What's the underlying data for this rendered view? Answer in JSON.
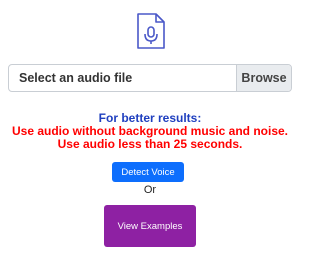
{
  "file_picker": {
    "label": "Select an audio file",
    "browse_label": "Browse"
  },
  "tips": {
    "heading": "For better results:",
    "line1": "Use audio without background music and noise.",
    "line2": "Use audio less than 25 seconds."
  },
  "actions": {
    "detect_label": "Detect Voice",
    "or_text": "Or",
    "examples_label": "View Examples"
  },
  "icons": {
    "file": "audio-file-icon"
  },
  "colors": {
    "icon": "#4a58c8",
    "heading": "#1f3fbf",
    "warning": "#ff0000",
    "detect_button": "#0d6efd",
    "examples_button": "#8e21a3"
  }
}
